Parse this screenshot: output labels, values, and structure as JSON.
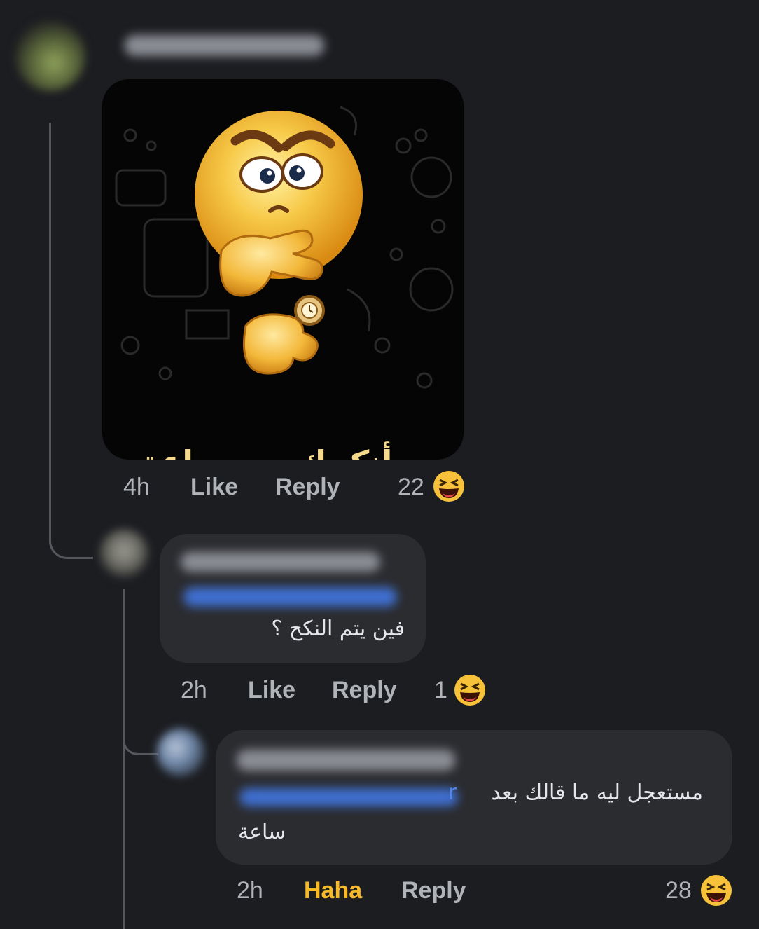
{
  "comment_1": {
    "image_caption": "سأنكحك بعد ساعة",
    "time": "4h",
    "like_label": "Like",
    "reply_label": "Reply",
    "reaction_count": "22",
    "reaction_icon": "laughing-emoji-icon"
  },
  "comment_2": {
    "text": "فين يتم النكح ؟",
    "time": "2h",
    "like_label": "Like",
    "reply_label": "Reply",
    "reaction_count": "1",
    "reaction_icon": "laughing-emoji-icon"
  },
  "comment_3": {
    "text_line_1": "مستعجل ليه ما قالك بعد",
    "mention_tail": "r",
    "text_line_2": "ساعة",
    "time": "2h",
    "reaction_label": "Haha",
    "reply_label": "Reply",
    "reaction_count": "28",
    "reaction_icon": "laughing-emoji-icon"
  },
  "colors": {
    "background": "#1c1d21",
    "bubble": "#2b2c30",
    "muted_text": "#b0b3b8",
    "haha_active": "#f7b928",
    "mention": "#3f6fd0"
  }
}
